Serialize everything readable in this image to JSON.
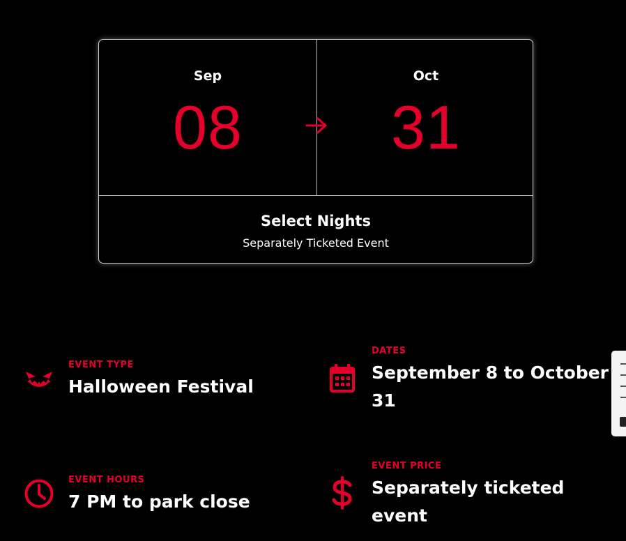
{
  "date_range": {
    "start": {
      "month": "Sep",
      "day": "08"
    },
    "end": {
      "month": "Oct",
      "day": "31"
    },
    "title": "Select Nights",
    "subtitle": "Separately Ticketed Event"
  },
  "details": [
    {
      "label": "EVENT TYPE",
      "value": "Halloween Festival",
      "icon": "pumpkin-face-icon"
    },
    {
      "label": "DATES",
      "value": "September 8 to October 31",
      "icon": "calendar-icon"
    },
    {
      "label": "EVENT HOURS",
      "value": "7 PM to park close",
      "icon": "clock-icon"
    },
    {
      "label": "EVENT PRICE",
      "value": "Separately ticketed event",
      "icon": "dollar-icon"
    }
  ],
  "colors": {
    "accent": "#e4002b",
    "background": "#000000",
    "text": "#ffffff"
  }
}
